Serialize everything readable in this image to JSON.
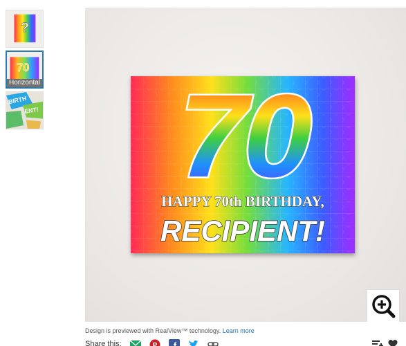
{
  "thumbnails": [
    {
      "label": "",
      "selected": false,
      "icon": "portrait-puzzle-thumbnail"
    },
    {
      "label": "Horizontal",
      "selected": true,
      "icon": "horizontal-puzzle-thumbnail"
    },
    {
      "label": "",
      "selected": false,
      "icon": "loose-pieces-thumbnail"
    }
  ],
  "product": {
    "big_number": "70",
    "line1": "HAPPY 70th BIRTHDAY,",
    "line2": "RECIPIENT!"
  },
  "caption": {
    "text": "Design is previewed with RealView™ technology.",
    "link": "Learn more"
  },
  "share": {
    "label": "Share this:",
    "icons": [
      "email-icon",
      "pinterest-icon",
      "facebook-icon",
      "twitter-icon",
      "link-icon"
    ]
  },
  "colors": {
    "selected_border": "#2a7ab0",
    "link": "#1a6fb1",
    "email": "#1ea363",
    "pinterest": "#cb2027",
    "facebook": "#3b5998",
    "twitter": "#1da1f2"
  }
}
